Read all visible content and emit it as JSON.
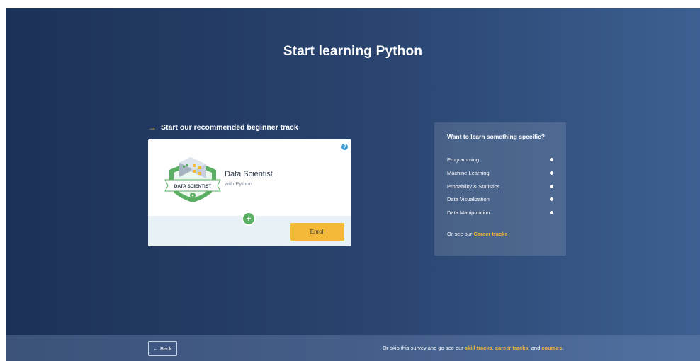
{
  "page": {
    "title": "Start learning Python"
  },
  "recommended": {
    "heading": "Start our recommended beginner track",
    "track": {
      "name": "Data Scientist",
      "subtitle": "with Python",
      "badge_text": "DATA SCIENTIST",
      "enroll_label": "Enroll"
    }
  },
  "specific": {
    "title": "Want to learn something specific?",
    "topics": [
      {
        "label": "Programming"
      },
      {
        "label": "Machine Learning"
      },
      {
        "label": "Probability & Statistics"
      },
      {
        "label": "Data Visualization"
      },
      {
        "label": "Data Manipulation"
      }
    ],
    "footer_prefix": "Or see our",
    "footer_link": "Career tracks"
  },
  "footer": {
    "back_label": "← Back",
    "skip_prefix": "Or skip this survey and go see our",
    "skill_tracks": "skill tracks",
    "comma": ",",
    "career_tracks": "career tracks",
    "and_text": ", and",
    "courses": "courses",
    "period": "."
  },
  "colors": {
    "accent": "#f5b939",
    "background_dark": "#1c3157",
    "background_light": "#3d5f91",
    "badge_green": "#5aaf63",
    "info_blue": "#3a9bd9"
  },
  "icons": [
    "arrow-right-icon",
    "info-icon",
    "plus-icon",
    "data-scientist-badge"
  ]
}
